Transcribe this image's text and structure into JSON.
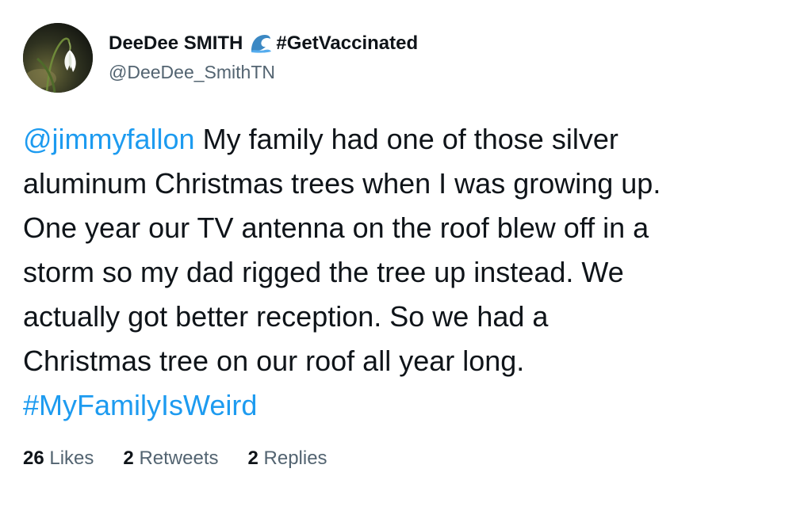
{
  "author": {
    "display_name": "DeeDee SMITH",
    "name_emoji": "water-wave-icon",
    "name_hashtag": "#GetVaccinated",
    "handle": "@DeeDee_SmithTN"
  },
  "tweet": {
    "lines": [
      {
        "mention": "@jimmyfallon",
        "text": " My family had one of those silver"
      },
      {
        "text": "aluminum Christmas trees when I was growing up."
      },
      {
        "text": "One year our TV antenna on the roof blew off in a"
      },
      {
        "text": "storm so my dad rigged the tree up instead. We"
      },
      {
        "text": "actually got better reception. So we had a"
      },
      {
        "text": "Christmas tree on our roof all year long."
      }
    ],
    "hashtag": "#MyFamilyIsWeird"
  },
  "stats": {
    "likes_count": "26",
    "likes_label": "Likes",
    "retweets_count": "2",
    "retweets_label": "Retweets",
    "replies_count": "2",
    "replies_label": "Replies"
  },
  "colors": {
    "link": "#1d9bf0",
    "text": "#0f1419",
    "secondary": "#536471"
  }
}
